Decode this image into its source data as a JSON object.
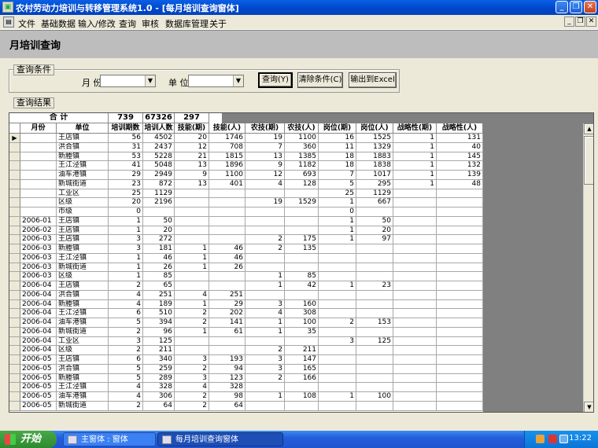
{
  "window": {
    "title": "农村劳动力培训与转移管理系统1.0 - [每月培训查询窗体]"
  },
  "menu": {
    "items": [
      "文件",
      "基础数据",
      "输入/修改",
      "查询",
      "审核",
      "数据库管理",
      "关于"
    ]
  },
  "page": {
    "title": "月培训查询"
  },
  "query": {
    "group_label": "查询条件",
    "month_label": "月 份",
    "month_value": "",
    "unit_label": "单 位",
    "unit_value": "",
    "query_button": "查询(Y)",
    "clear_button": "清除条件(C)",
    "export_button": "输出到Excel"
  },
  "results": {
    "group_label": "查询结果",
    "totals_label": "合      计",
    "totals": [
      "739",
      "67326",
      "297"
    ],
    "columns": [
      "月份",
      "单位",
      "培训期数",
      "培训人数",
      "技能(期)",
      "技能(人)",
      "农技(期)",
      "农技(人)",
      "岗位(期)",
      "岗位(人)",
      "战略性(期)",
      "战略性(人)"
    ],
    "rows": [
      [
        "",
        "王店镇",
        "56",
        "4502",
        "20",
        "1746",
        "19",
        "1100",
        "16",
        "1525",
        "1",
        "131"
      ],
      [
        "",
        "洪合镇",
        "31",
        "2437",
        "12",
        "708",
        "7",
        "360",
        "11",
        "1329",
        "1",
        "40"
      ],
      [
        "",
        "新塍镇",
        "53",
        "5228",
        "21",
        "1815",
        "13",
        "1385",
        "18",
        "1883",
        "1",
        "145"
      ],
      [
        "",
        "王江泾镇",
        "41",
        "5048",
        "13",
        "1896",
        "9",
        "1182",
        "18",
        "1838",
        "1",
        "132"
      ],
      [
        "",
        "油车港镇",
        "29",
        "2949",
        "9",
        "1100",
        "12",
        "693",
        "7",
        "1017",
        "1",
        "139"
      ],
      [
        "",
        "新城街道",
        "23",
        "872",
        "13",
        "401",
        "4",
        "128",
        "5",
        "295",
        "1",
        "48"
      ],
      [
        "",
        "工业区",
        "25",
        "1129",
        "",
        "",
        "",
        "",
        "25",
        "1129",
        "",
        ""
      ],
      [
        "",
        "区级",
        "20",
        "2196",
        "",
        "",
        "19",
        "1529",
        "1",
        "667",
        "",
        ""
      ],
      [
        "",
        "市级",
        "0",
        "",
        "",
        "",
        "",
        "",
        "0",
        "",
        "",
        ""
      ],
      [
        "2006-01",
        "王店镇",
        "1",
        "50",
        "",
        "",
        "",
        "",
        "1",
        "50",
        "",
        ""
      ],
      [
        "2006-02",
        "王店镇",
        "1",
        "20",
        "",
        "",
        "",
        "",
        "1",
        "20",
        "",
        ""
      ],
      [
        "2006-03",
        "王店镇",
        "3",
        "272",
        "",
        "",
        "2",
        "175",
        "1",
        "97",
        "",
        ""
      ],
      [
        "2006-03",
        "新塍镇",
        "3",
        "181",
        "1",
        "46",
        "2",
        "135",
        "",
        "",
        "",
        ""
      ],
      [
        "2006-03",
        "王江泾镇",
        "1",
        "46",
        "1",
        "46",
        "",
        "",
        "",
        "",
        "",
        ""
      ],
      [
        "2006-03",
        "新城街道",
        "1",
        "26",
        "1",
        "26",
        "",
        "",
        "",
        "",
        "",
        ""
      ],
      [
        "2006-03",
        "区级",
        "1",
        "85",
        "",
        "",
        "1",
        "85",
        "",
        "",
        "",
        ""
      ],
      [
        "2006-04",
        "王店镇",
        "2",
        "65",
        "",
        "",
        "1",
        "42",
        "1",
        "23",
        "",
        ""
      ],
      [
        "2006-04",
        "洪合镇",
        "4",
        "251",
        "4",
        "251",
        "",
        "",
        "",
        "",
        "",
        ""
      ],
      [
        "2006-04",
        "新塍镇",
        "4",
        "189",
        "1",
        "29",
        "3",
        "160",
        "",
        "",
        "",
        ""
      ],
      [
        "2006-04",
        "王江泾镇",
        "6",
        "510",
        "2",
        "202",
        "4",
        "308",
        "",
        "",
        "",
        ""
      ],
      [
        "2006-04",
        "油车港镇",
        "5",
        "394",
        "2",
        "141",
        "1",
        "100",
        "2",
        "153",
        "",
        ""
      ],
      [
        "2006-04",
        "新城街道",
        "2",
        "96",
        "1",
        "61",
        "1",
        "35",
        "",
        "",
        "",
        ""
      ],
      [
        "2006-04",
        "工业区",
        "3",
        "125",
        "",
        "",
        "",
        "",
        "3",
        "125",
        "",
        ""
      ],
      [
        "2006-04",
        "区级",
        "2",
        "211",
        "",
        "",
        "2",
        "211",
        "",
        "",
        "",
        ""
      ],
      [
        "2006-05",
        "王店镇",
        "6",
        "340",
        "3",
        "193",
        "3",
        "147",
        "",
        "",
        "",
        ""
      ],
      [
        "2006-05",
        "洪合镇",
        "5",
        "259",
        "2",
        "94",
        "3",
        "165",
        "",
        "",
        "",
        ""
      ],
      [
        "2006-05",
        "新塍镇",
        "5",
        "289",
        "3",
        "123",
        "2",
        "166",
        "",
        "",
        "",
        ""
      ],
      [
        "2006-05",
        "王江泾镇",
        "4",
        "328",
        "4",
        "328",
        "",
        "",
        "",
        "",
        "",
        ""
      ],
      [
        "2006-05",
        "油车港镇",
        "4",
        "306",
        "2",
        "98",
        "1",
        "108",
        "1",
        "100",
        "",
        ""
      ],
      [
        "2006-05",
        "新城街道",
        "2",
        "64",
        "2",
        "64",
        "",
        "",
        "",
        "",
        "",
        ""
      ]
    ]
  },
  "taskbar": {
    "start_label": "开始",
    "tasks": [
      "主窗体 : 窗体",
      "每月培训查询窗体"
    ],
    "clock": "13:22"
  }
}
